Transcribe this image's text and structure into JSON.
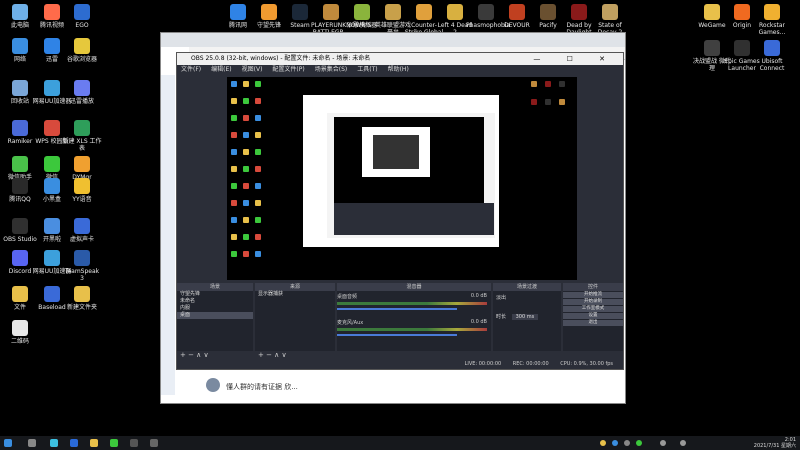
{
  "desktop": {
    "left_icons": [
      {
        "label": "此电脑",
        "color": "#6fb0e8"
      },
      {
        "label": "腾讯视频",
        "color": "#ff6b4a"
      },
      {
        "label": "EGO",
        "color": "#2d6cd0"
      },
      {
        "label": "网络",
        "color": "#3a8ee0"
      },
      {
        "label": "迅雷",
        "color": "#2f83e6"
      },
      {
        "label": "谷歌浏览器",
        "color": "#e6c83c"
      },
      {
        "label": "回收站",
        "color": "#7aa6d8"
      },
      {
        "label": "网易UU加速器",
        "color": "#3ca0dc"
      },
      {
        "label": "迅雷播放",
        "color": "#6a7cf0"
      },
      {
        "label": "Ramiker",
        "color": "#4a6ad8"
      },
      {
        "label": "WPS 校园版",
        "color": "#d84a3c"
      },
      {
        "label": "新建 XLS 工作表",
        "color": "#2e9e5a"
      },
      {
        "label": "微信助手",
        "color": "#4ac24a"
      },
      {
        "label": "微信",
        "color": "#3cc83c"
      },
      {
        "label": "DYMgr",
        "color": "#f0a030"
      },
      {
        "label": "腾讯QQ",
        "color": "#2a2a2a"
      },
      {
        "label": "小黑盒",
        "color": "#3a8ee0"
      },
      {
        "label": "YY语音",
        "color": "#f0c030"
      },
      {
        "label": "OBS Studio",
        "color": "#303030"
      },
      {
        "label": "开黑啦",
        "color": "#4a8ee0"
      },
      {
        "label": "虚拟声卡",
        "color": "#3a6ad8"
      },
      {
        "label": "Discord",
        "color": "#5865f2"
      },
      {
        "label": "网易UU加速器",
        "color": "#3ca0dc"
      },
      {
        "label": "TeamSpeak 3",
        "color": "#2a5aa8"
      },
      {
        "label": "文件",
        "color": "#e8c04a"
      },
      {
        "label": "Baseload",
        "color": "#3a6ad8"
      },
      {
        "label": "新建文件夹",
        "color": "#e8c04a"
      },
      {
        "label": "二维码",
        "color": "#e8e8e8"
      }
    ],
    "top_icons": [
      {
        "label": "腾讯网",
        "color": "#2f83e6"
      },
      {
        "label": "守望先锋",
        "color": "#f09a30"
      },
      {
        "label": "Steam",
        "color": "#1b2838"
      },
      {
        "label": "PLAYERUNKNOWN'S BATTLEGR...",
        "color": "#c08a3c"
      },
      {
        "label": "沙雕模拟器",
        "color": "#8ab43c"
      },
      {
        "label": "英雄联盟游戏平台",
        "color": "#c8a04a"
      },
      {
        "label": "Counter-Strike Global Off...",
        "color": "#e0a03c"
      },
      {
        "label": "Left 4 Dead 2",
        "color": "#d8b040"
      },
      {
        "label": "Phasmophobia",
        "color": "#3a3a3a"
      },
      {
        "label": "DEVOUR",
        "color": "#c04020"
      },
      {
        "label": "Pacify",
        "color": "#6a5030"
      },
      {
        "label": "Dead by Daylight",
        "color": "#8a1a1a"
      },
      {
        "label": "State of Decay 2",
        "color": "#c0a060"
      }
    ],
    "right_icons": [
      {
        "label": "WeGame",
        "color": "#e8c04a"
      },
      {
        "label": "Origin",
        "color": "#f06a20"
      },
      {
        "label": "Rockstar Games...",
        "color": "#f0b030"
      },
      {
        "label": "决战盟战 微代理",
        "color": "#404040"
      },
      {
        "label": "Epic Games Launcher",
        "color": "#303030"
      },
      {
        "label": "Ubisoft Connect",
        "color": "#3a6ad8"
      }
    ]
  },
  "browser": {
    "chat_preview": "懂人群的请有证据 欣..."
  },
  "obs": {
    "title": "OBS 25.0.8 (32-bit, windows) - 配置文件: 未命名 - 场景: 未命名",
    "window_buttons": "—  ☐  ✕",
    "menu": [
      "文件(F)",
      "编辑(E)",
      "视图(V)",
      "配置文件(P)",
      "场景集合(S)",
      "工具(T)",
      "帮助(H)"
    ],
    "docks": {
      "scenes_title": "场景",
      "sources_title": "来源",
      "mixer_title": "混音器",
      "transitions_title": "场景过渡",
      "controls_title": "控件"
    },
    "scenes": [
      "守望先锋",
      "未命名",
      "内服",
      "桌面"
    ],
    "sources": [
      "显示器捕获"
    ],
    "mixer": [
      {
        "name": "桌面音频",
        "level": "0.0 dB"
      },
      {
        "name": "麦克风/Aux",
        "level": "0.0 dB"
      }
    ],
    "transition": {
      "type": "淡出",
      "duration_label": "时长",
      "duration": "300 ms"
    },
    "controls": [
      "开始推流",
      "开始录制",
      "工作室模式",
      "设置",
      "退出"
    ],
    "status": {
      "live": "LIVE: 00:00:00",
      "rec": "REC: 00:00:00",
      "cpu": "CPU: 0.9%, 30.00 fps"
    },
    "dock_footer": "+ −  ∧ ∨"
  },
  "taskbar": {
    "time": "2:01",
    "date": "2021/7/31 星期六"
  }
}
